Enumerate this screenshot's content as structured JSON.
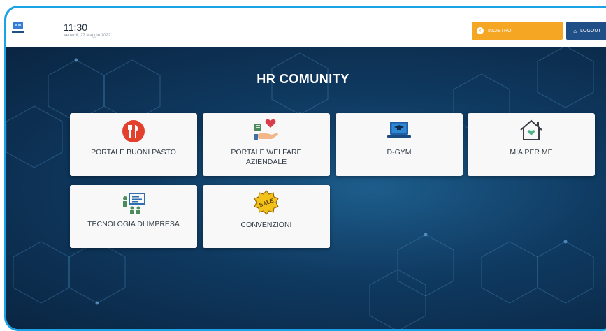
{
  "header": {
    "time": "11:30",
    "date": "Venerdì, 27 Maggio 2022",
    "back_label": "INDIETRO",
    "logout_label": "LOGOUT"
  },
  "page": {
    "title": "HR COMUNITY"
  },
  "cards": [
    {
      "label": "PORTALE BUONI PASTO",
      "icon": "fork-knife-icon"
    },
    {
      "label": "PORTALE WELFARE AZIENDALE",
      "icon": "heart-hand-icon"
    },
    {
      "label": "D-GYM",
      "icon": "laptop-graduation-icon"
    },
    {
      "label": "MIA PER ME",
      "icon": "house-heart-icon"
    },
    {
      "label": "TECNOLOGIA DI IMPRESA",
      "icon": "presentation-icon"
    },
    {
      "label": "CONVENZIONI",
      "icon": "sale-badge-icon",
      "badge_text": "SALE"
    }
  ],
  "colors": {
    "accent_frame": "#1aa3e6",
    "back_button": "#f5a623",
    "logout_button": "#1f4f86",
    "background": "#0f3a61"
  }
}
